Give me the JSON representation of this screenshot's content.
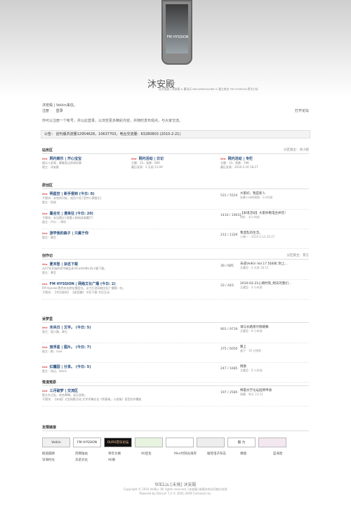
{
  "header": {
    "site_name": "沐安殿",
    "site_sub": "吴方迷迷 | 沐安殿 & 魔法乐 WKLDMAGAZINE & 猫之电台 FM HYSSION 原生小站",
    "phone_logo": "FM HYSSION"
  },
  "user": {
    "greeting": "沐安殿 | Veikin来信。",
    "login": "注册",
    "logout": "登录",
    "print": "打开论坛"
  },
  "intro": "你可以注册一个帐号，并以此登录，以浏览更多精彩内容，并随时发布观点，与大家交流。",
  "notice": "公告：  创刊版共流量12954628，10637703，电台交流量：63280803 (2010-2-21)",
  "sections": [
    {
      "title": "站务区",
      "right": "分区版主：沐小殿",
      "forums": [
        {
          "name": "网内娱乐 | 开心宝宝",
          "sub": "娱乐八卦版，聊聊身边奇闻异事",
          "mod": "版主：沐安殿"
        },
        {
          "name": "网内活动 | 日记",
          "sub": "主题：33，帖数：669",
          "mod": "最后发表：3 天前 11:09"
        },
        {
          "name": "网内活动 | 专栏",
          "sub": "主题：14，帖数：196",
          "mod": "最后发表：2010-2-16 18:27"
        }
      ]
    },
    {
      "title": "原创区",
      "right": "",
      "forums": [
        {
          "name": "明星控 | 新手报到 (今日: 8)",
          "sub": "子版块：未完的闪轮，成员介绍 [宣传小窝版主]",
          "mod": "版主：阿成",
          "stat": "531 / 5524",
          "last": "大家好，我是新人",
          "last_t": "安静小诗的阁楼 · 1小时前"
        },
        {
          "name": "暮合光 | 漫来往 (今日: 20)",
          "sub": "子版块：永见随记  [观看入物阅读收藏厅]",
          "mod": "版主：(Yx) ... 明轩",
          "stat": "1410 / 19031",
          "last": "【未境活动】大家你看电台并花！",
          "last_t": "明轩 · 半小时前"
        },
        {
          "name": "游学我的森子 | 只属于你",
          "sub": "",
          "mod": "版主：景言",
          "stat": "212 / 1329",
          "last": "我混乱的生活。",
          "last_t": "小咖一 · 2010-2-12 20:27"
        }
      ]
    },
    {
      "title": "创作记",
      "right": "分区版主：景言",
      "forums": [
        {
          "name": "夏末愁 | 杂志下载",
          "sub": "从07年开始的初中精品读书CastleNo.的小猫下载。",
          "mod": "版主：景言",
          "stat": "30 / 685",
          "last": "未成VeiKin Vol.17 封光机 刻上...",
          "last_t": "艾藏型 · 4 天前 18:12"
        },
        {
          "name": "FM HYSSION | 网络文化广播 (今日: 2)",
          "sub": "FM Hyssion黑色杂志转化播音台，全力打造网络文化广播第一台。",
          "mod": "子版块：【节目收听】 【录音棚】 节目下载 节目互动",
          "stat": "33 / 443",
          "last": "2010-02-21心情时刻_明天的我们...",
          "last_t": "艾藏型 · 4 小时前"
        }
      ]
    },
    {
      "title": "诉梦里",
      "right": "",
      "forums": [
        {
          "name": "未央日 | 文字。 (今日: 5)",
          "sub": "版主：饭小路，林生",
          "mod": "",
          "stat": "901 / 9719",
          "last": "请与长路意仟情跳舞",
          "last_t": "艾藏型 · 8 小时前"
        },
        {
          "name": "旅浮星 | 图片。 (今日: 7)",
          "sub": "版主：鹤，nine",
          "mod": "",
          "stat": "375 / 6050",
          "last": "路上",
          "last_t": "盒子 · 19 分钟前"
        },
        {
          "name": "红霾园 | 分享。 (今日: 5)",
          "sub": "版主：雨过，devin",
          "mod": "",
          "stat": "247 / 1685",
          "last": "情歌",
          "last_t": "艾藏型 · 6 小时前"
        }
      ]
    },
    {
      "title": "荒漠荒原",
      "right": "",
      "forums": [
        {
          "name": "三月破梦 | 交流区",
          "sub": "版主办之际，吃吃喝喝。谈天说地。",
          "mod": "子版块：【未成】大型电影活动  文学评稿办法《秀客栈，小说栈》语音合作播放",
          "stat": "197 / 2585",
          "last": "稀雷文学论坛招牌申请",
          "last_t": "翔翼 · 昨天 13:31"
        }
      ]
    }
  ],
  "friends_title": "友情链接",
  "friend_logos": [
    "Veikin",
    "FM HYSSION",
    "OURS音乐论坛",
    "",
    "",
    "",
    "魅 力",
    ""
  ],
  "friend_links": [
    [
      "掘道圆顾",
      "风锦陆站",
      "青年文摘",
      "90后生",
      "Men时刻光海岸",
      "服等电子杂志",
      "嗅嗅",
      "蓝海星"
    ],
    [
      "深海时光",
      "沃诺文化",
      "90春"
    ]
  ],
  "footer": {
    "brand": "WKLin [未境] 沐安殿",
    "line1": "Copyright © 2010 VeiKin. All rights reserved. [未安殿] 新版本的访问统计信息",
    "line2": "Powered by Discuz! 7.2 © 2001-2009 Comsenz Inc."
  }
}
